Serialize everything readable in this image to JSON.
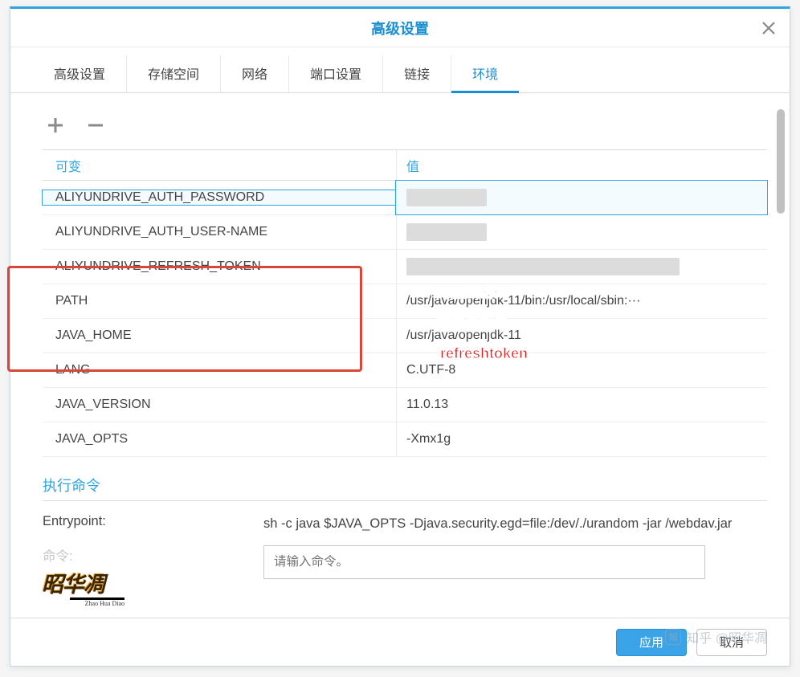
{
  "dialog": {
    "title": "高级设置"
  },
  "tabs": {
    "items": [
      {
        "label": "高级设置"
      },
      {
        "label": "存储空间"
      },
      {
        "label": "网络"
      },
      {
        "label": "端口设置"
      },
      {
        "label": "链接"
      },
      {
        "label": "环境"
      }
    ],
    "active_index": 5
  },
  "env_table": {
    "header_key": "可变",
    "header_val": "值",
    "rows": [
      {
        "key": "ALIYUNDRIVE_AUTH_PASSWORD",
        "val": "",
        "blurred": true,
        "blur_w": 100
      },
      {
        "key": "ALIYUNDRIVE_AUTH_USER-NAME",
        "val": "",
        "blurred": true,
        "blur_w": 100
      },
      {
        "key": "ALIYUNDRIVE_REFRESH_TOKEN",
        "val": "",
        "blurred": true,
        "blur_w": 340
      },
      {
        "key": "PATH",
        "val": "/usr/java/openjdk-11/bin:/usr/local/sbin:···"
      },
      {
        "key": "JAVA_HOME",
        "val": "/usr/java/openjdk-11"
      },
      {
        "key": "LANG",
        "val": "C.UTF-8"
      },
      {
        "key": "JAVA_VERSION",
        "val": "11.0.13"
      },
      {
        "key": "JAVA_OPTS",
        "val": "-Xmx1g"
      }
    ],
    "selected_index": 0
  },
  "annotations": {
    "a1": "阿里云密码",
    "a2": "阿里云账号",
    "a3": "refreshtoken"
  },
  "exec": {
    "title": "执行命令",
    "entrypoint_label": "Entrypoint:",
    "entrypoint_value": "sh -c java $JAVA_OPTS -Djava.security.egd=file:/dev/./urandom -jar /webdav.jar",
    "cmd_label": "命令:",
    "cmd_placeholder": "请输入命令。"
  },
  "footer": {
    "apply": "应用",
    "cancel": "取消"
  },
  "watermark": {
    "text": "昭华凋",
    "sub": "Zhao Hua Diao",
    "zhihu": "知乎 @昭华凋"
  }
}
